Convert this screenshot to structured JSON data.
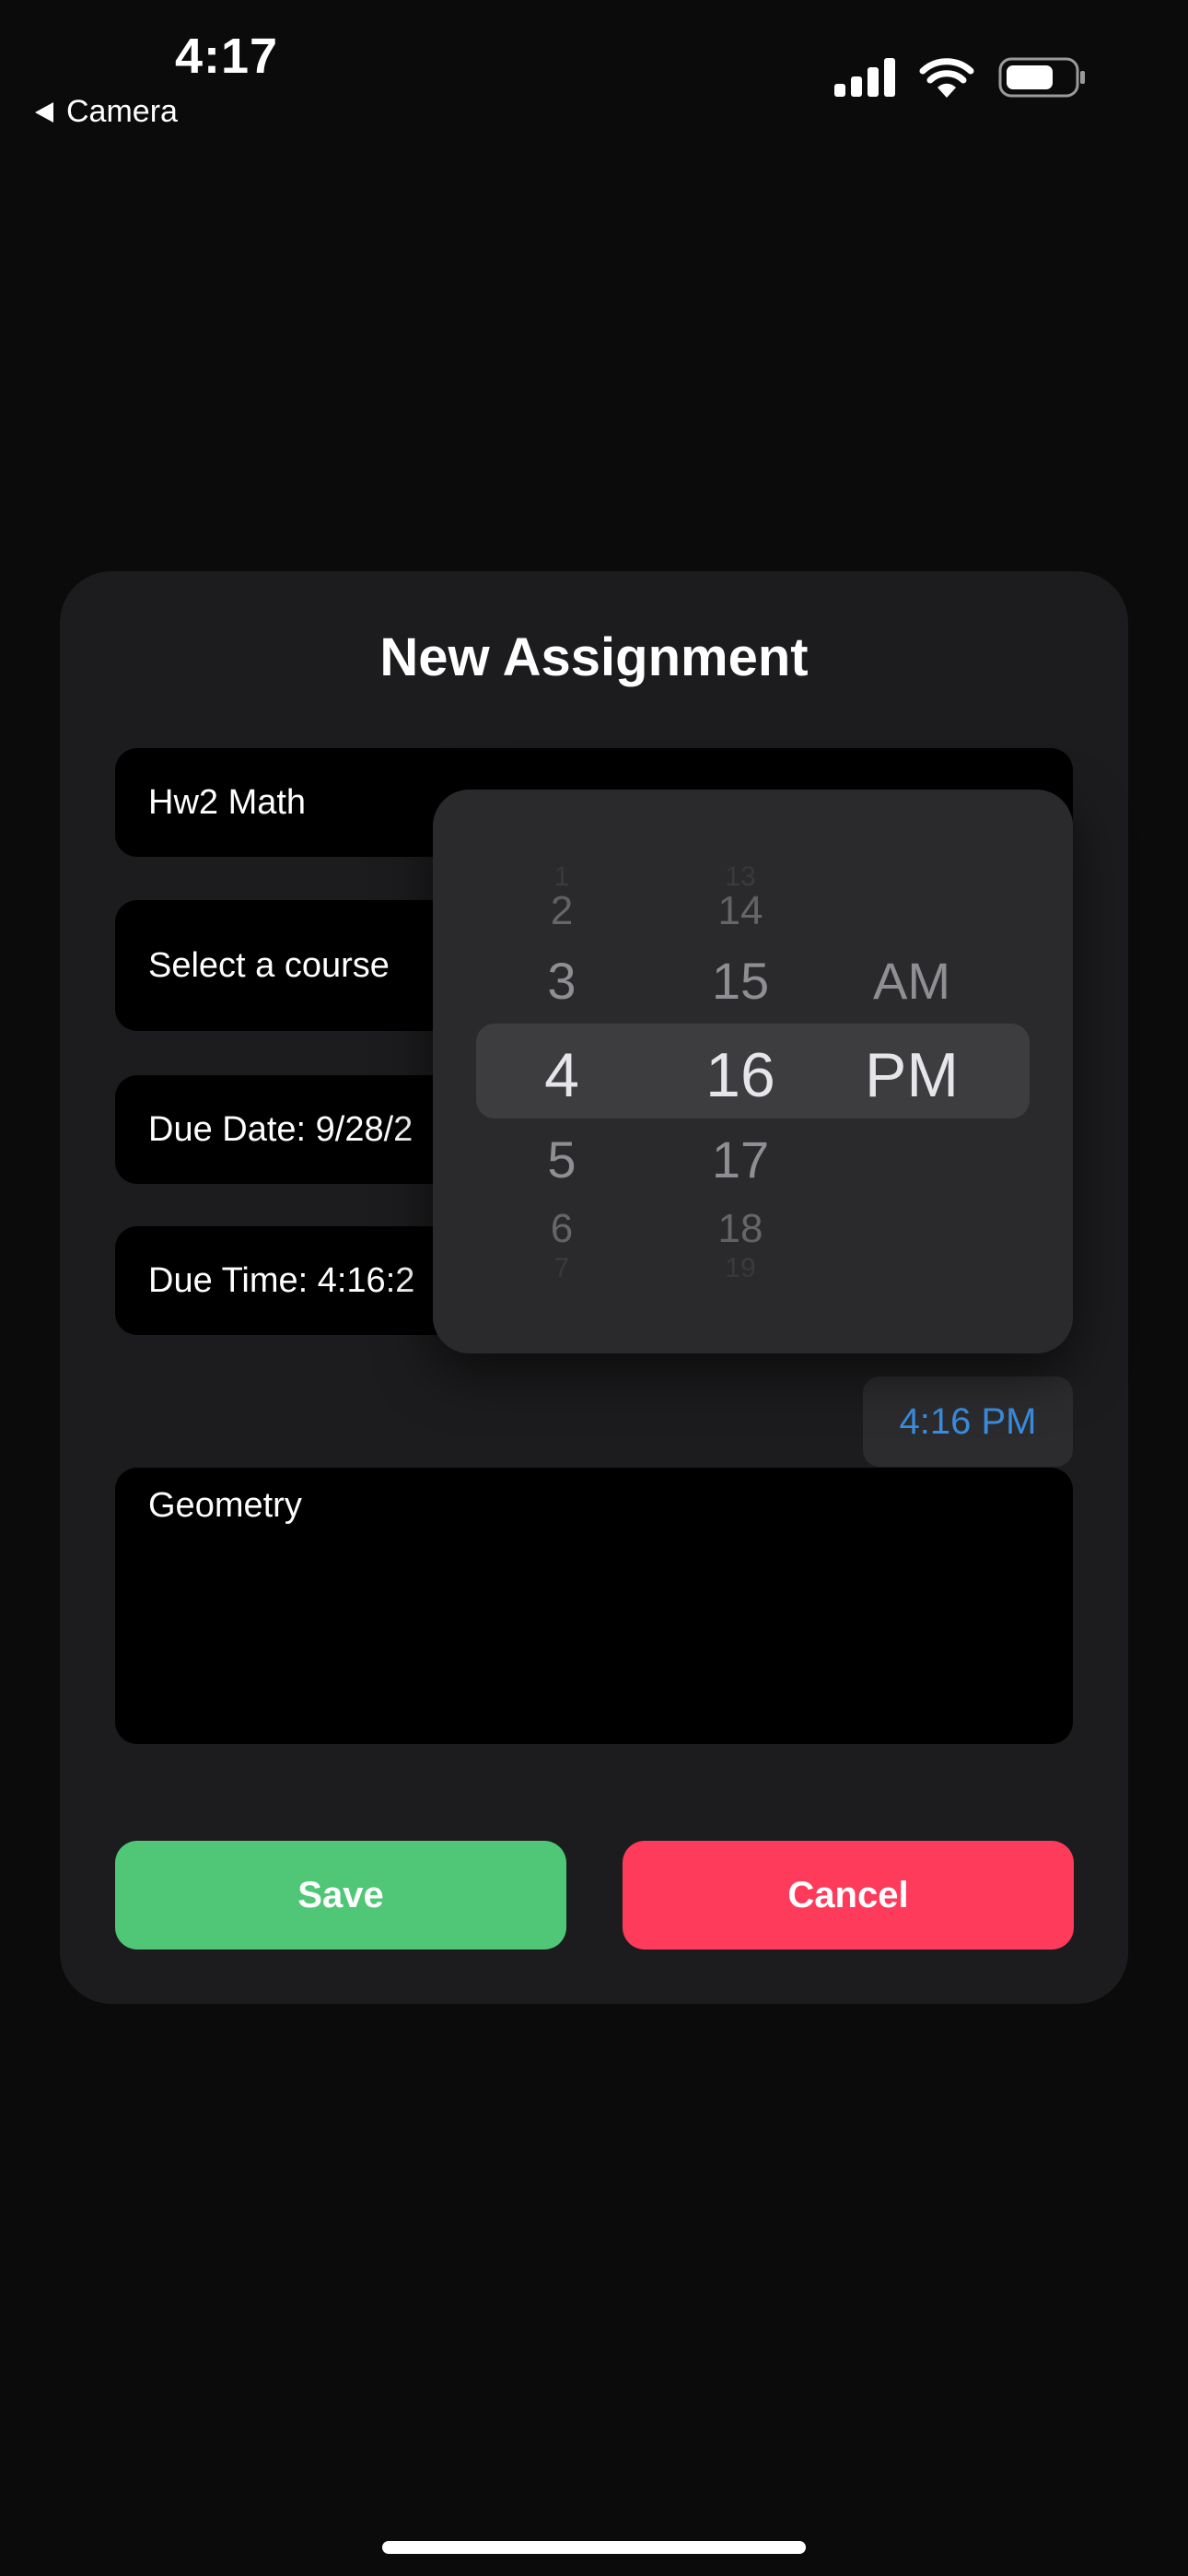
{
  "status_bar": {
    "time": "4:17",
    "back_label": "Camera",
    "icons": [
      "signal-bars-icon",
      "wifi-icon",
      "battery-icon"
    ]
  },
  "dialog": {
    "title": "New Assignment",
    "fields": {
      "title_value": "Hw2 Math",
      "course_placeholder": "Select a course",
      "due_date": "Due Date: 9/28/2",
      "due_time": "Due Time: 4:16:2",
      "notes_value": "Geometry"
    },
    "time_chip": "4:16 PM",
    "save_label": "Save",
    "cancel_label": "Cancel"
  },
  "time_picker": {
    "hours": [
      "1",
      "2",
      "3",
      "4",
      "5",
      "6",
      "7"
    ],
    "minutes": [
      "13",
      "14",
      "15",
      "16",
      "17",
      "18",
      "19"
    ],
    "periods": [
      "AM",
      "PM"
    ],
    "selected": {
      "hour": "4",
      "minute": "16",
      "period": "PM"
    }
  },
  "colors": {
    "background": "#0b0b0b",
    "card": "#1c1c1e",
    "picker": "#2a2a2c",
    "save": "#4fc776",
    "cancel": "#ff3b5b",
    "accent_time": "#3a8dde"
  }
}
